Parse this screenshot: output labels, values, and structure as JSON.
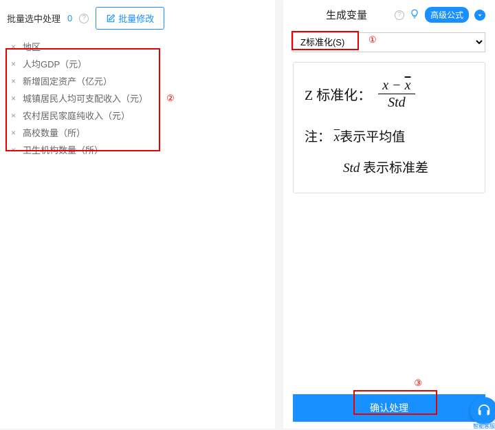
{
  "left": {
    "header_label": "批量选中处理",
    "count": "0",
    "batch_edit_label": "批量修改",
    "variables": [
      "地区",
      "人均GDP（元）",
      "新增固定资产（亿元）",
      "城镇居民人均可支配收入（元）",
      "农村居民家庭纯收入（元）",
      "高校数量（所）",
      "卫生机构数量（所）"
    ]
  },
  "right": {
    "title": "生成变量",
    "adv_formula_label": "高级公式",
    "method_selected": "Z标准化(S)",
    "formula": {
      "prefix": "Z 标准化：",
      "numer": "x − x̄",
      "denom": "Std",
      "note_prefix": "注：",
      "note_xbar": "x",
      "note_xbar_tail": "表示平均值",
      "note_std_head": "Std",
      "note_std_tail": " 表示标准差"
    },
    "confirm_label": "确认处理"
  },
  "annotations": {
    "one": "①",
    "two": "②",
    "three": "③"
  },
  "float_service_label": "智能客服"
}
